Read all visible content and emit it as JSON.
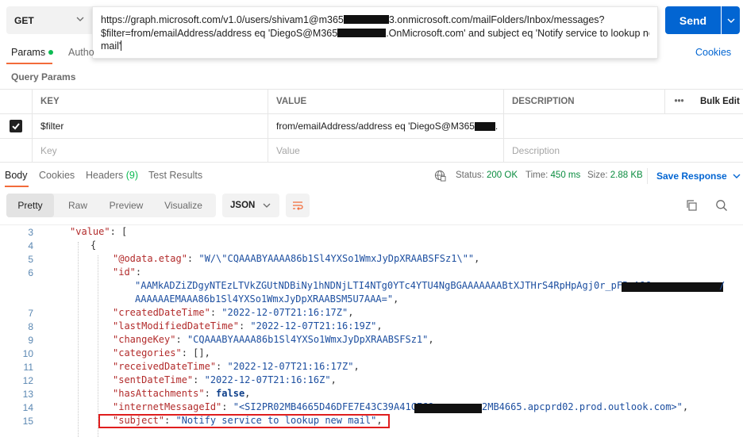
{
  "request": {
    "method": "GET",
    "url_lines": [
      {
        "before": "https://graph.microsoft.com/v1.0/users/shivam1@m365",
        "after": "3.onmicrosoft.com/mailFolders/Inbox/messages?"
      },
      {
        "before": "$filter=from/emailAddress/address eq 'DiegoS@M365",
        "after": ".OnMicrosoft.com' and subject eq 'Notify service to lookup new"
      },
      {
        "before": "mail'",
        "after": ""
      }
    ],
    "send_label": "Send"
  },
  "request_tabs": {
    "params": "Params",
    "authorization": "Autho",
    "cookies": "Cookies"
  },
  "query_params": {
    "title": "Query Params",
    "headers": {
      "key": "KEY",
      "value": "VALUE",
      "description": "DESCRIPTION",
      "more": "•••",
      "bulk_edit": "Bulk Edit"
    },
    "row": {
      "checked": true,
      "key": "$filter",
      "value": "from/emailAddress/address eq 'DiegoS@M365",
      "value_tail": "."
    },
    "placeholders": {
      "key": "Key",
      "value": "Value",
      "description": "Description"
    }
  },
  "response_tabs": {
    "body": "Body",
    "cookies": "Cookies",
    "headers": "Headers",
    "headers_count": "(9)",
    "test_results": "Test Results"
  },
  "response_meta": {
    "status_label": "Status:",
    "status_value": "200 OK",
    "time_label": "Time:",
    "time_value": "450 ms",
    "size_label": "Size:",
    "size_value": "2.88 KB",
    "save_response": "Save Response"
  },
  "view": {
    "modes": [
      "Pretty",
      "Raw",
      "Preview",
      "Visualize"
    ],
    "active_mode": "Pretty",
    "format": "JSON"
  },
  "code_lines": {
    "l3": {
      "num": "3",
      "key": "\"value\"",
      "rest": ": ["
    },
    "l4": {
      "num": "4",
      "text": "{"
    },
    "l5": {
      "num": "5",
      "key": "\"@odata.etag\"",
      "colon": ": ",
      "val": "\"W/\\\"CQAAABYAAAA86b1Sl4YXSo1WmxJyDpXRAABSFSz1\\\"\"",
      "tail": ","
    },
    "l6": {
      "num": "6",
      "key": "\"id\"",
      "colon": ":"
    },
    "l6a": {
      "val": "\"AAMkADZiZDgyNTEzLTVkZGUtNDBiNy1hNDNjLTI4NTg0YTc4YTU4NgBGAAAAAAABtXJTHrS4RpHpAgj0r_pFBwA86",
      "tail": "/"
    },
    "l6b": {
      "val": "AAAAAAEMAAA86b1Sl4YXSo1WmxJyDpXRAABSM5U7AAA=\"",
      "tail": ","
    },
    "l7": {
      "num": "7",
      "key": "\"createdDateTime\"",
      "colon": ": ",
      "val": "\"2022-12-07T21:16:17Z\"",
      "tail": ","
    },
    "l8": {
      "num": "8",
      "key": "\"lastModifiedDateTime\"",
      "colon": ": ",
      "val": "\"2022-12-07T21:16:19Z\"",
      "tail": ","
    },
    "l9": {
      "num": "9",
      "key": "\"changeKey\"",
      "colon": ": ",
      "val": "\"CQAAABYAAAA86b1Sl4YXSo1WmxJyDpXRAABSFSz1\"",
      "tail": ","
    },
    "l10": {
      "num": "10",
      "key": "\"categories\"",
      "colon": ": ",
      "val": "[]",
      "tail": ","
    },
    "l11": {
      "num": "11",
      "key": "\"receivedDateTime\"",
      "colon": ": ",
      "val": "\"2022-12-07T21:16:17Z\"",
      "tail": ","
    },
    "l12": {
      "num": "12",
      "key": "\"sentDateTime\"",
      "colon": ": ",
      "val": "\"2022-12-07T21:16:16Z\"",
      "tail": ","
    },
    "l13": {
      "num": "13",
      "key": "\"hasAttachments\"",
      "colon": ": ",
      "val": "false",
      "tail": ","
    },
    "l14": {
      "num": "14",
      "key": "\"internetMessageId\"",
      "colon": ": ",
      "val": "\"<SI2PR02MB4665D46DFE7E43C39A41CE69",
      "val2": "2MB4665.apcprd02.prod.outlook.com>\"",
      "tail": ","
    },
    "l15": {
      "num": "15",
      "key": "\"subject\"",
      "colon": ": ",
      "val": "\"Notify service to lookup new mail\"",
      "tail": ","
    }
  },
  "colors": {
    "send": "#0265d2",
    "accent_tab": "#f26b3a",
    "status_ok": "#0cbb52",
    "json_key": "#b22b2b",
    "json_string": "#1d4fa0",
    "highlight": "#e01e1e"
  }
}
